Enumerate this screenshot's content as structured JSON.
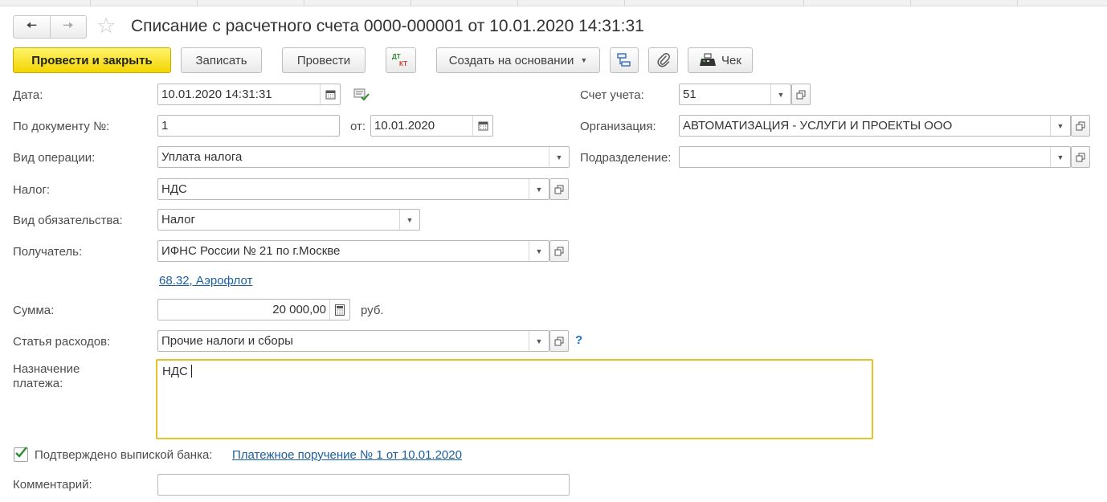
{
  "window": {
    "title": "Списание с расчетного счета 0000-000001 от 10.01.2020 14:31:31",
    "back_icon": "arrow-left-icon",
    "forward_icon": "arrow-right-icon",
    "favorite_icon": "star-icon"
  },
  "toolbar": {
    "post_and_close": "Провести и закрыть",
    "save": "Записать",
    "post": "Провести",
    "dtkt_icon": "dt-kt-icon",
    "create_based_on": "Создать на основании",
    "structure_icon": "document-structure-icon",
    "attach_icon": "paperclip-icon",
    "receipt_label": "Чек",
    "receipt_icon": "cash-register-icon"
  },
  "form": {
    "date": {
      "label": "Дата:",
      "value": "10.01.2020 14:31:31"
    },
    "doc_number": {
      "label": "По документу №:",
      "value": "1"
    },
    "doc_date": {
      "label": "от:",
      "value": "10.01.2020"
    },
    "operation_type": {
      "label": "Вид операции:",
      "value": "Уплата налога"
    },
    "tax": {
      "label": "Налог:",
      "value": "НДС"
    },
    "liability_type": {
      "label": "Вид обязательства:",
      "value": "Налог"
    },
    "recipient": {
      "label": "Получатель:",
      "value": "ИФНС России № 21 по г.Москве"
    },
    "account_link": "68.32, Аэрофлот",
    "amount": {
      "label": "Сумма:",
      "value": "20 000,00",
      "currency": "руб."
    },
    "expense_item": {
      "label": "Статья расходов:",
      "value": "Прочие налоги и сборы",
      "help": "?"
    },
    "purpose": {
      "label_line1": "Назначение",
      "label_line2": "платежа:",
      "value": "НДС"
    },
    "confirmed": {
      "checked": true,
      "label": "Подтверждено выпиской банка:",
      "link": "Платежное поручение № 1 от 10.01.2020"
    },
    "comment": {
      "label": "Комментарий:",
      "value": ""
    },
    "account": {
      "label": "Счет учета:",
      "value": "51"
    },
    "organization": {
      "label": "Организация:",
      "value": "АВТОМАТИЗАЦИЯ - УСЛУГИ И ПРОЕКТЫ ООО"
    },
    "department": {
      "label": "Подразделение:",
      "value": ""
    }
  },
  "colors": {
    "primary_button": "#f7e01e",
    "link": "#1b5e9e",
    "active_field_border": "#e3c42a",
    "check": "#2e8b2e"
  }
}
